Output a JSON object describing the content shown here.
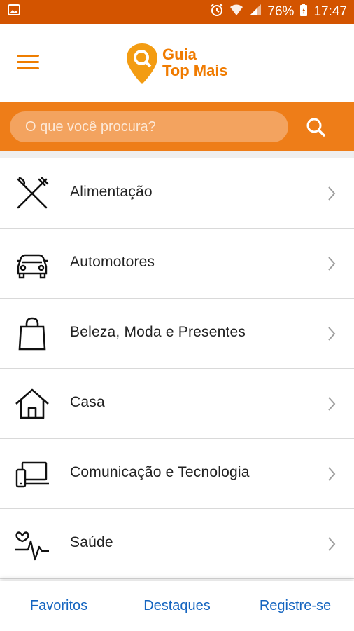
{
  "status": {
    "battery": "76%",
    "time": "17:47",
    "icons": [
      "image-icon",
      "alarm-icon",
      "wifi-icon",
      "signal-icon",
      "battery-charging-icon"
    ]
  },
  "header": {
    "logo_line1": "Guia",
    "logo_line2": "Top Mais",
    "menu_icon": "hamburger-icon"
  },
  "search": {
    "placeholder": "O que você procura?",
    "icon": "search-icon"
  },
  "categories": [
    {
      "label": "Alimentação",
      "icon": "fork-knife-icon"
    },
    {
      "label": "Automotores",
      "icon": "car-icon"
    },
    {
      "label": "Beleza, Moda e Presentes",
      "icon": "shopping-bag-icon"
    },
    {
      "label": "Casa",
      "icon": "house-icon"
    },
    {
      "label": "Comunicação e Tecnologia",
      "icon": "devices-icon"
    },
    {
      "label": "Saúde",
      "icon": "heartbeat-icon"
    }
  ],
  "bottom_nav": {
    "favoritos": "Favoritos",
    "destaques": "Destaques",
    "registre": "Registre-se"
  },
  "colors": {
    "status_bar": "#d35400",
    "accent": "#ee7d18",
    "link": "#1565c0"
  }
}
